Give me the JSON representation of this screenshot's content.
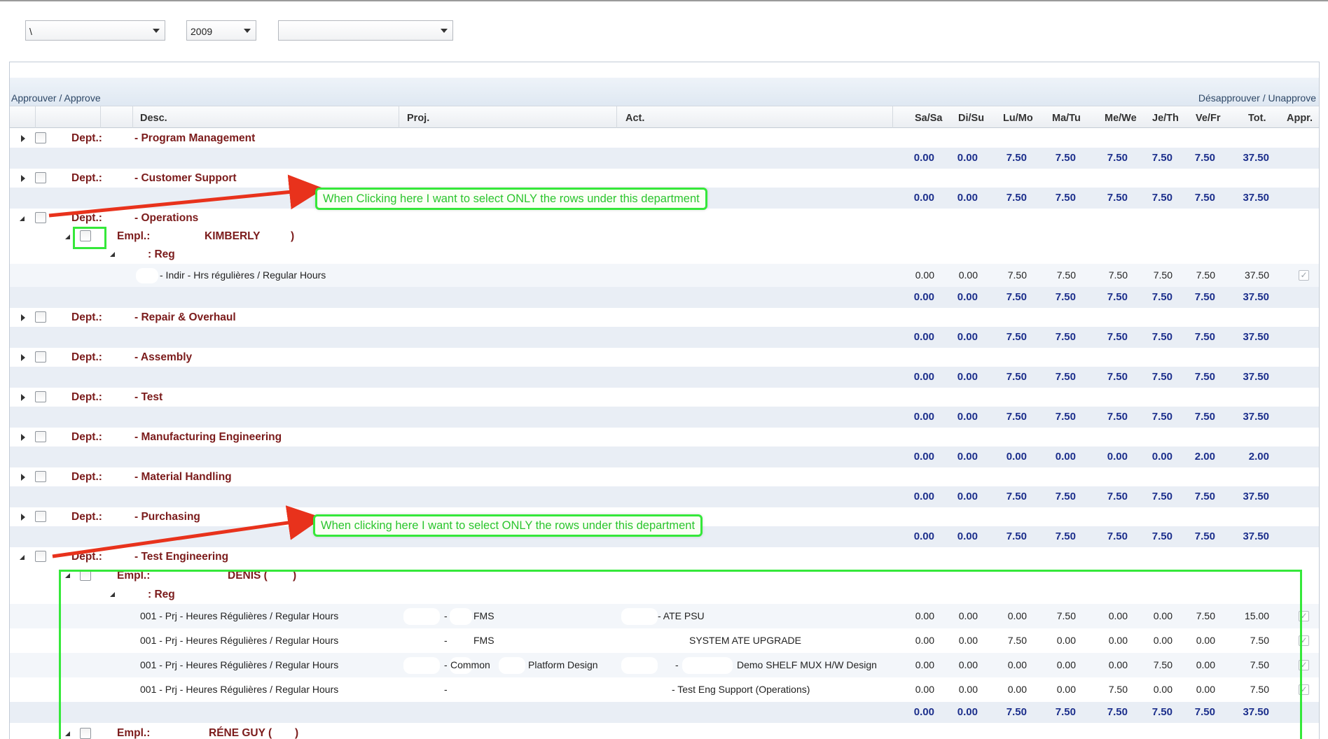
{
  "filters": {
    "first_value": "\\",
    "year_value": "2009",
    "third_value": ""
  },
  "actions": {
    "approve": "Approuver / Approve",
    "unapprove": "Désapprouver / Unapprove"
  },
  "columns": {
    "desc": "Desc.",
    "proj": "Proj.",
    "act": "Act.",
    "sa": "Sa/Sa",
    "di": "Di/Su",
    "lu": "Lu/Mo",
    "ma": "Ma/Tu",
    "me": "Me/We",
    "je": "Je/Th",
    "ve": "Ve/Fr",
    "tot": "Tot.",
    "appr": "Appr."
  },
  "labels": {
    "dept": "Dept.:",
    "empl": "Empl.:",
    "reg": ": Reg"
  },
  "departments": [
    {
      "name": "- Program Management",
      "totals": [
        "0.00",
        "0.00",
        "7.50",
        "7.50",
        "7.50",
        "7.50",
        "7.50",
        "37.50"
      ]
    },
    {
      "name": "- Customer Support",
      "totals": [
        "0.00",
        "0.00",
        "7.50",
        "7.50",
        "7.50",
        "7.50",
        "7.50",
        "37.50"
      ]
    },
    {
      "name": "- Operations",
      "totals": [
        "0.00",
        "0.00",
        "7.50",
        "7.50",
        "7.50",
        "7.50",
        "7.50",
        "37.50"
      ]
    },
    {
      "name": "- Repair & Overhaul",
      "totals": [
        "0.00",
        "0.00",
        "7.50",
        "7.50",
        "7.50",
        "7.50",
        "7.50",
        "37.50"
      ]
    },
    {
      "name": "- Assembly",
      "totals": [
        "0.00",
        "0.00",
        "7.50",
        "7.50",
        "7.50",
        "7.50",
        "7.50",
        "37.50"
      ]
    },
    {
      "name": "- Test",
      "totals": [
        "0.00",
        "0.00",
        "7.50",
        "7.50",
        "7.50",
        "7.50",
        "7.50",
        "37.50"
      ]
    },
    {
      "name": "- Manufacturing Engineering",
      "totals": [
        "0.00",
        "0.00",
        "0.00",
        "0.00",
        "0.00",
        "0.00",
        "2.00",
        "2.00"
      ]
    },
    {
      "name": "- Material Handling",
      "totals": [
        "0.00",
        "0.00",
        "7.50",
        "7.50",
        "7.50",
        "7.50",
        "7.50",
        "37.50"
      ]
    },
    {
      "name": "- Purchasing",
      "totals": [
        "0.00",
        "0.00",
        "7.50",
        "7.50",
        "7.50",
        "7.50",
        "7.50",
        "37.50"
      ]
    },
    {
      "name": "- Test Engineering",
      "totals": []
    }
  ],
  "operations": {
    "employee": "KIMBERLY",
    "paren": ")",
    "line": {
      "desc": "- Indir - Hrs régulières / Regular Hours",
      "values": [
        "0.00",
        "0.00",
        "7.50",
        "7.50",
        "7.50",
        "7.50",
        "7.50",
        "37.50"
      ]
    },
    "employee_totals": [
      "0.00",
      "0.00",
      "7.50",
      "7.50",
      "7.50",
      "7.50",
      "7.50",
      "37.50"
    ]
  },
  "test_engineering": {
    "employee": "DENIS (",
    "paren": ")",
    "lines": [
      {
        "desc": "001 - Prj - Heures Régulières / Regular Hours",
        "proj_a": "-",
        "proj_b": "FMS",
        "act": "- ATE PSU",
        "values": [
          "0.00",
          "0.00",
          "0.00",
          "7.50",
          "0.00",
          "0.00",
          "7.50",
          "15.00"
        ]
      },
      {
        "desc": "001 - Prj - Heures Régulières / Regular Hours",
        "proj_a": "-",
        "proj_b": "FMS",
        "act": "SYSTEM ATE UPGRADE",
        "values": [
          "0.00",
          "0.00",
          "7.50",
          "0.00",
          "0.00",
          "0.00",
          "0.00",
          "7.50"
        ]
      },
      {
        "desc": "001 - Prj - Heures Régulières / Regular Hours",
        "proj_a": "-",
        "proj_b": "Common",
        "proj_c": "Platform Design",
        "act_a": "-",
        "act": "Demo SHELF MUX H/W Design",
        "values": [
          "0.00",
          "0.00",
          "0.00",
          "0.00",
          "0.00",
          "7.50",
          "0.00",
          "7.50"
        ]
      },
      {
        "desc": "001 - Prj - Heures Régulières / Regular Hours",
        "proj_a": "-",
        "act": "- Test Eng Support (Operations)",
        "values": [
          "0.00",
          "0.00",
          "0.00",
          "0.00",
          "7.50",
          "0.00",
          "0.00",
          "7.50"
        ]
      }
    ],
    "employee_totals": [
      "0.00",
      "0.00",
      "7.50",
      "7.50",
      "7.50",
      "7.50",
      "7.50",
      "37.50"
    ],
    "next_employee": "RÉNE GUY (",
    "next_paren": ")"
  },
  "annotations": {
    "callout_1": "When Clicking here I want to select ONLY the rows under this department",
    "callout_2": "When clicking here I want to select ONLY the rows under this department",
    "color": "#35e83a",
    "arrow_color": "#e8321c"
  }
}
